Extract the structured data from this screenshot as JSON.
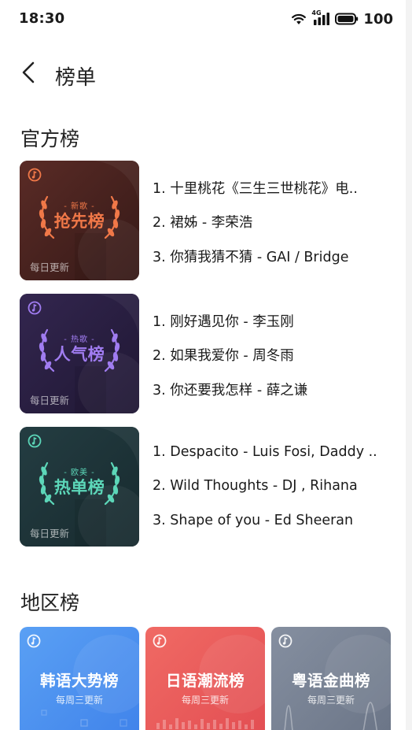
{
  "status_bar": {
    "time": "18:30",
    "network": "4G",
    "battery": "100"
  },
  "header": {
    "title": "榜单",
    "back_icon": "chevron-left-icon"
  },
  "official": {
    "title": "官方榜",
    "charts": [
      {
        "tag": "- 新歌 -",
        "name": "抢先榜",
        "update": "每日更新",
        "colors": {
          "bg": "#4a2424",
          "accent": "#f07848"
        },
        "tracks": [
          "1. 十里桃花《三生三世桃花》电..",
          "2. 裙姊 - 李荣浩",
          "3. 你猜我猜不猜 - GAI / Bridge"
        ]
      },
      {
        "tag": "- 热歌 -",
        "name": "人气榜",
        "update": "每日更新",
        "colors": {
          "bg": "#2c2046",
          "accent": "#a07cf0"
        },
        "tracks": [
          "1. 刚好遇见你 - 李玉刚",
          "2. 如果我爱你 - 周冬雨",
          "3. 你还要我怎样 - 薛之谦"
        ]
      },
      {
        "tag": "- 欧美 -",
        "name": "热单榜",
        "update": "每日更新",
        "colors": {
          "bg": "#1e3338",
          "accent": "#5cd6b8"
        },
        "tracks": [
          "1. Despacito - Luis Fosi, Daddy ..",
          "2. Wild Thoughts - DJ , Rihana",
          "3. Shape of you - Ed Sheeran"
        ]
      }
    ]
  },
  "regional": {
    "title": "地区榜",
    "charts": [
      {
        "name": "韩语大势榜",
        "update": "每周三更新",
        "color": "#4a8ff0"
      },
      {
        "name": "日语潮流榜",
        "update": "每周三更新",
        "color": "#ec5a5a"
      },
      {
        "name": "粤语金曲榜",
        "update": "每周三更新",
        "color": "#7a8496"
      }
    ]
  }
}
